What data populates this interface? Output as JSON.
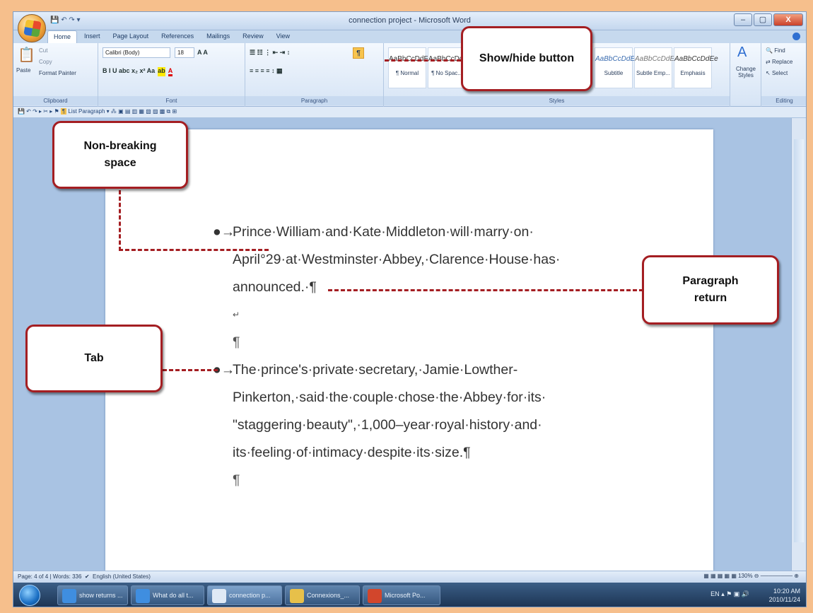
{
  "window": {
    "title": "connection project - Microsoft Word",
    "controls": [
      "–",
      "▢",
      "X"
    ]
  },
  "tabs": [
    "Home",
    "Insert",
    "Page Layout",
    "References",
    "Mailings",
    "Review",
    "View"
  ],
  "clipboard": {
    "paste": "Paste",
    "cut": "Cut",
    "copy": "Copy",
    "format_painter": "Format Painter",
    "label": "Clipboard"
  },
  "font": {
    "name": "Calibri (Body)",
    "size": "18",
    "label": "Font"
  },
  "paragraph": {
    "label": "Paragraph",
    "show_hide": "¶"
  },
  "styles": {
    "label": "Styles",
    "items": [
      {
        "preview": "AaBbCcDdEe",
        "name": "¶ Normal"
      },
      {
        "preview": "AaBbCcDdEe",
        "name": "¶ No Spac..."
      },
      {
        "preview": "AaBbCcDdEe",
        "name": "Subtitle"
      },
      {
        "preview": "AaBbCcDdEe",
        "name": "Subtle Emp..."
      },
      {
        "preview": "AaBbCcDdEe",
        "name": "Emphasis"
      }
    ],
    "change_styles": "Change Styles"
  },
  "editing": {
    "find": "Find",
    "replace": "Replace",
    "select": "Select",
    "label": "Editing"
  },
  "qat_style": "List Paragraph",
  "document": {
    "p1": [
      "Prince·William·and·Kate·Middleton·will·marry·on·",
      "April°29·at·Westminster·Abbey,·Clarence·House·has·",
      "announced.·¶"
    ],
    "line_break": "↵",
    "empty_para": "¶",
    "p2": [
      "The·prince's·private·secretary,·Jamie·Lowther-",
      "Pinkerton,·said·the·couple·chose·the·Abbey·for·its·",
      "\"staggering·beauty\",·1,000–year·royal·history·and·",
      "its·feeling·of·intimacy·despite·its·size.¶"
    ],
    "final_para": "¶"
  },
  "callouts": {
    "show_hide": "Show/hide button",
    "non_breaking": "Non-breaking space",
    "paragraph_return": "Paragraph return",
    "tab": "Tab"
  },
  "status": {
    "page": "Page: 4 of 4",
    "words": "Words: 336",
    "language": "English (United States)",
    "zoom": "130%"
  },
  "taskbar": {
    "items": [
      "show returns ...",
      "What do all t...",
      "connection p...",
      "Connexions_...",
      "Microsoft Po..."
    ],
    "lang": "EN",
    "time": "10:20 AM",
    "date": "2010/11/24"
  }
}
